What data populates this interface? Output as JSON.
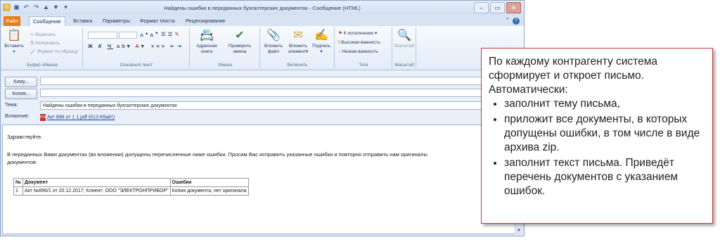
{
  "window": {
    "title": "Найдены ошибки в переданных бухгалтерских документах - Сообщение (HTML)"
  },
  "tabs": [
    {
      "label": "Файл"
    },
    {
      "label": "Сообщение"
    },
    {
      "label": "Вставка"
    },
    {
      "label": "Параметры"
    },
    {
      "label": "Формат текста"
    },
    {
      "label": "Рецензирование"
    }
  ],
  "ribbon": {
    "clipboard": {
      "paste": "Вставить",
      "cut": "Вырезать",
      "copy": "Копировать",
      "format_painter": "Формат по образцу",
      "label": "Буфер обмена"
    },
    "basic_text": {
      "label": "Основной текст"
    },
    "names": {
      "address_book_1": "Адресная",
      "address_book_2": "книга",
      "check_names_1": "Проверить",
      "check_names_2": "имена",
      "label": "Имена"
    },
    "include": {
      "attach_file_1": "Вложить",
      "attach_file_2": "файл",
      "attach_item_1": "Вложить",
      "attach_item_2": "элемент",
      "signature_1": "Подпись",
      "label": "Включить"
    },
    "tags": {
      "followup": "К исполнению",
      "high": "Высокая важность",
      "low": "Низкая важность",
      "label": "Теги"
    },
    "zoom": {
      "button": "Масштаб",
      "label": "Масштаб"
    }
  },
  "header": {
    "to_button": "Кому...",
    "cc_button": "Копия...",
    "subject_label": "Тема:",
    "subject_value": "Найдены ошибки в переданных бухгалтерских документах",
    "attach_label": "Вложение:",
    "attachment": "Акт  896  от  1  1.pdf (613 Кбайт)"
  },
  "message": {
    "greeting": "Здравствуйте.",
    "text_line1": "В переданных Вами документах (во вложении) допущены перечисленные ниже ошибки. Просим Вас исправить указанные ошибки и повторно отправить нам оригиналы",
    "text_line2": "документов.",
    "table": {
      "headers": [
        "№",
        "Документ",
        "Ошибки"
      ],
      "rows": [
        [
          "1",
          "Акт №896/1 от 20.12.2017; Клиент: ООО \"ЭЛЕКТРОНПРИБОР\"",
          "Копия документа, нет оригинала"
        ]
      ]
    }
  },
  "callout": {
    "intro": "По каждому контрагенту система сформирует и откроет письмо. Автоматически:",
    "items": [
      "заполнит тему письма,",
      "приложит все документы, в которых допущены ошибки, в том числе в виде архива zip.",
      "заполнит текст письма. Приведёт перечень документов с указанием ошибок."
    ]
  }
}
